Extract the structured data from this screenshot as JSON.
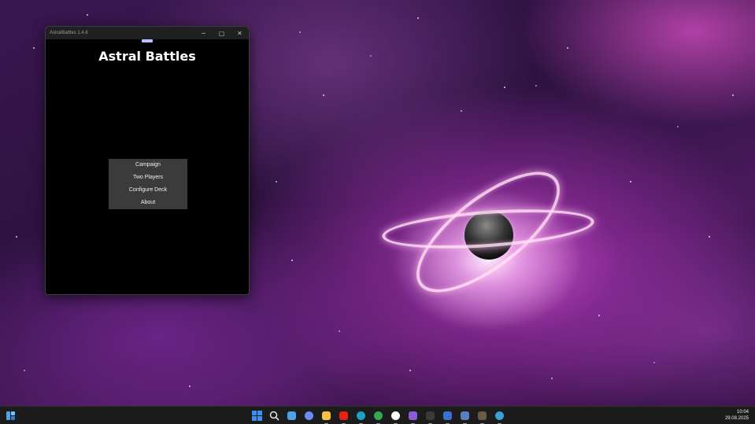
{
  "window": {
    "title": "AstralBattles 1.4.6",
    "minimize_glyph": "─",
    "maximize_glyph": "▢",
    "close_glyph": "✕"
  },
  "game": {
    "title": "Astral Battles",
    "menu": [
      {
        "label": "Campaign"
      },
      {
        "label": "Two Players"
      },
      {
        "label": "Configure Deck"
      },
      {
        "label": "About"
      }
    ]
  },
  "taskbar": {
    "icons": [
      {
        "name": "windows-start-icon",
        "color": "#3b8ff0"
      },
      {
        "name": "search-icon",
        "color": "#e0e0e0"
      },
      {
        "name": "notepad-icon",
        "color": "#4aa3e8"
      },
      {
        "name": "copilot-icon",
        "color": "#6c8cf5"
      },
      {
        "name": "file-explorer-icon",
        "color": "#f5c242"
      },
      {
        "name": "youtube-icon",
        "color": "#e62117"
      },
      {
        "name": "edge-icon",
        "color": "#1fa0c9"
      },
      {
        "name": "chrome-icon",
        "color": "#34a853"
      },
      {
        "name": "yandex-icon",
        "color": "#ffffff"
      },
      {
        "name": "visual-studio-icon",
        "color": "#8b5cd6"
      },
      {
        "name": "terminal-icon",
        "color": "#3a3a3a"
      },
      {
        "name": "save-disk-icon",
        "color": "#3d6fd1"
      },
      {
        "name": "game-app-icon",
        "color": "#5a7fbf"
      },
      {
        "name": "character-app-icon",
        "color": "#6b5a40"
      },
      {
        "name": "globe-icon",
        "color": "#3aa0d8"
      }
    ],
    "clock": {
      "time": "10:04",
      "date": "29.08.2025"
    }
  }
}
